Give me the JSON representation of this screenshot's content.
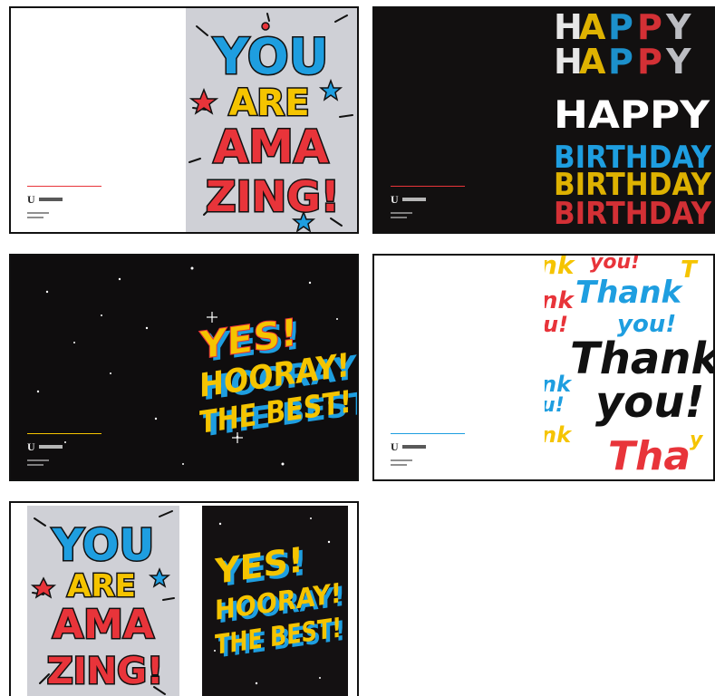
{
  "cards": [
    {
      "id": "amazing",
      "lines": [
        "YOU",
        "ARE",
        "AMA",
        "ZING!"
      ]
    },
    {
      "id": "birthday",
      "lines": [
        "HAPPY",
        "BIRTHDAY"
      ]
    },
    {
      "id": "hooray",
      "lines": [
        "YES!",
        "HOORAY!",
        "THE BEST!"
      ]
    },
    {
      "id": "thank-you",
      "lines": [
        "Thank",
        "you!"
      ]
    },
    {
      "id": "pair",
      "lines_left": [
        "YOU",
        "ARE",
        "AMA",
        "ZING!"
      ],
      "lines_right": [
        "YES!",
        "HOORAY!",
        "THE BEST!"
      ]
    }
  ],
  "colors": {
    "blue": "#1e9ee0",
    "yellow": "#f5c400",
    "red": "#e8343a",
    "white": "#ffffff",
    "black": "#111111",
    "grey_bg": "#cfd0d6"
  }
}
